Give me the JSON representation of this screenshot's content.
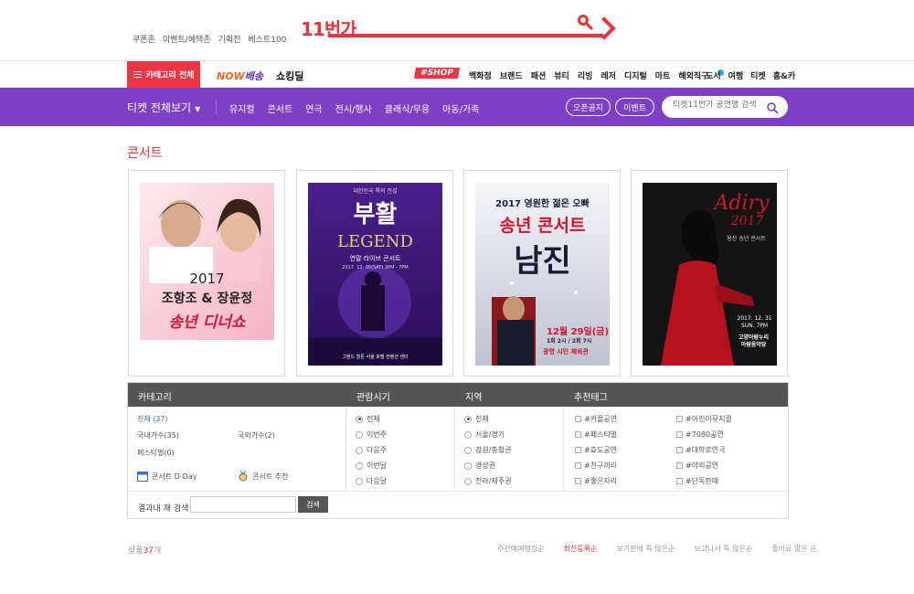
{
  "header": {
    "top_links": [
      "쿠폰존",
      "이벤트/혜택존",
      "기획전",
      "베스트100"
    ],
    "logo": "11번가"
  },
  "gnb": {
    "category_all": "카테고리 전체",
    "now_delivery_a": "NOW",
    "now_delivery_b": "배송",
    "shopping_deal_a": "쇼킹딜",
    "shopping_deal_b": "",
    "shop_badge": "#SHOP",
    "menu": [
      "백화점",
      "브랜드",
      "패션",
      "뷰티",
      "리빙",
      "레저",
      "디지털",
      "마트",
      "해외직구"
    ],
    "menu2": [
      "도서",
      "여행",
      "티켓",
      "홈&카"
    ]
  },
  "ticket_bar": {
    "all": "티켓 전체보기",
    "menu": [
      "뮤지컬",
      "콘서트",
      "연극",
      "전시/행사",
      "클래식/무용",
      "아동/가족"
    ],
    "btn_open": "오픈공지",
    "btn_event": "이벤트",
    "search_placeholder": "티켓11번가 공연명 검색"
  },
  "page_title": "콘서트",
  "posters": [
    {
      "year": "2017",
      "line1": "조항조 & 장윤정",
      "line2": "송년 디너쇼",
      "colors": [
        "#fbe6ea",
        "#f5b5c5"
      ]
    },
    {
      "top": "대한민국 록의 전설",
      "title": "부활",
      "sub": "LEGEND",
      "sub2": "연말 라이브 콘서트",
      "date": "2017. 12. 30(SAT) 3PM · 7PM",
      "venue": "그랜드 힐튼 서울 호텔 컨벤션 센터",
      "colors": [
        "#3b1d6e",
        "#6c3ab0"
      ]
    },
    {
      "top": "2017 영원한 젊은 오빠",
      "title": "송년 콘서트",
      "name": "남진",
      "date": "12월 29일(금)",
      "time": "1회 2시 / 2회 7시",
      "venue": "광명 시민 체육관",
      "colors": [
        "#eef0f5",
        "#c9ccd6"
      ]
    },
    {
      "script": "Adiry",
      "year": "2017",
      "sub": "용산 송년 콘서트",
      "date": "2017. 12. 31",
      "time": "SUN. 7PM",
      "venue1": "고양아람누리",
      "venue2": "아람음악당",
      "colors": [
        "#1a1a1a",
        "#3a3a3a"
      ]
    }
  ],
  "filter": {
    "headers": [
      "카테고리",
      "관람시기",
      "지역",
      "추천태그"
    ],
    "category": {
      "all": "전체 (37)",
      "items": [
        {
          "label": "국내가수(35)"
        },
        {
          "label": "국외가수(2)"
        },
        {
          "label": "페스티벌(0)"
        }
      ],
      "dday": "콘서트 D-Day",
      "recommend": "콘서트 추천"
    },
    "period": [
      "전체",
      "이번주",
      "다음주",
      "이번달",
      "다음달"
    ],
    "region": [
      "전체",
      "서울/경기",
      "강원/충청권",
      "경상권",
      "전라/제주권"
    ],
    "tags_left": [
      "#커플공연",
      "#페스티벌",
      "#효도공연",
      "#친구끼리",
      "#좋은자리"
    ],
    "tags_right": [
      "#어린이뮤지컬",
      "#7080공연",
      "#대학로연극",
      "#야외공연",
      "#단독판매"
    ],
    "search_label": "결과내 재 검색",
    "search_btn": "검색"
  },
  "result": {
    "prefix": "상품",
    "count": "37",
    "suffix": "개",
    "sorts": [
      "주간예매랭킹순",
      "최신등록순",
      "보기편에 특 많은순",
      "보고나서 특 많은순",
      "좋아요 많은 순"
    ]
  },
  "colors": {
    "brand_red": "#e8343f",
    "purple": "#7d3fc4",
    "filter_head": "#555555"
  }
}
